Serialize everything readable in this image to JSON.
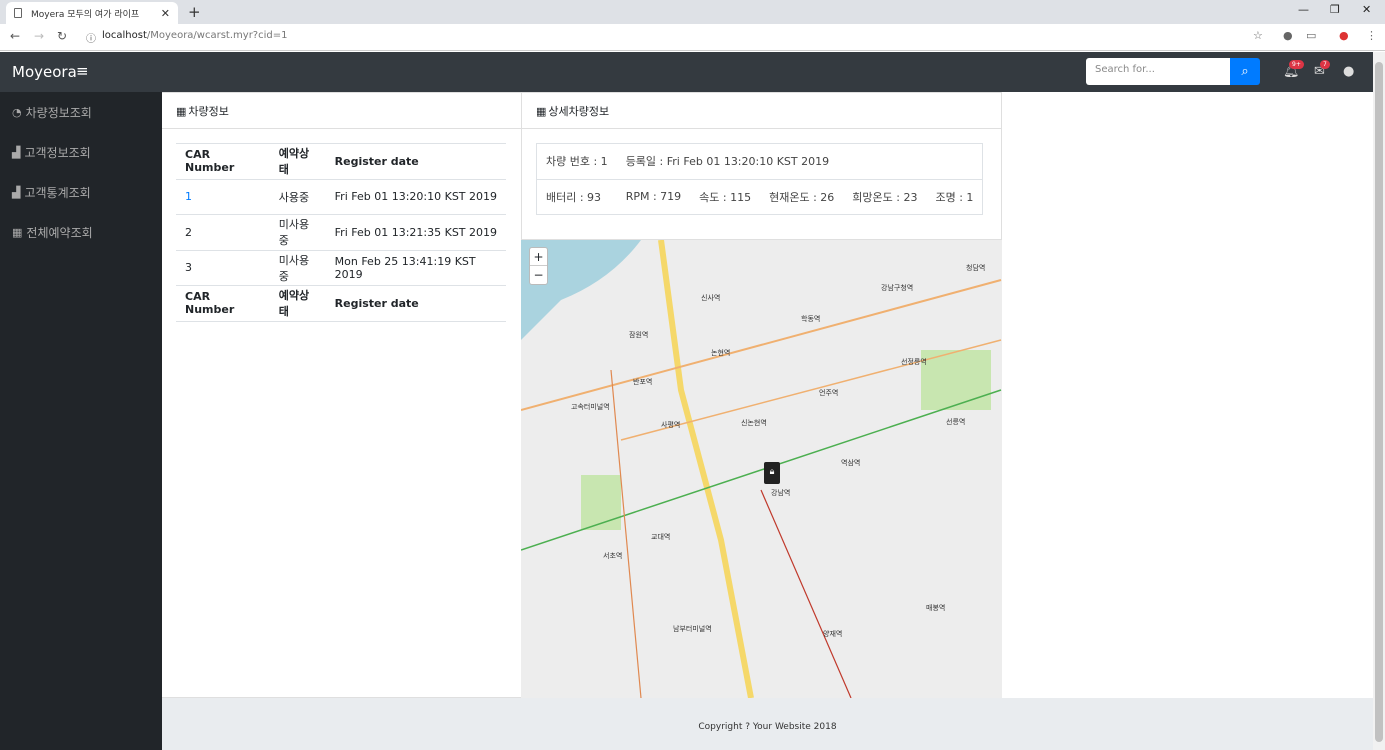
{
  "browser": {
    "tab_title": "Moyera 모두의 여가 라이프",
    "url_host": "localhost",
    "url_path": "/Moyeora/wcarst.myr?cid=1"
  },
  "header": {
    "brand": "Moyeora",
    "search_placeholder": "Search for...",
    "alerts_badge": "9+",
    "messages_badge": "7"
  },
  "sidebar": {
    "items": [
      {
        "label": "차량정보조회",
        "icon": "dashboard-icon"
      },
      {
        "label": "고객정보조회",
        "icon": "area-chart-icon"
      },
      {
        "label": "고객통계조회",
        "icon": "area-chart-icon"
      },
      {
        "label": "전체예약조회",
        "icon": "table-icon"
      }
    ]
  },
  "car_card": {
    "title": "차량정보",
    "headers": [
      "CAR Number",
      "예약상태",
      "Register date"
    ],
    "rows": [
      [
        "1",
        "사용중",
        "Fri Feb 01 13:20:10 KST 2019"
      ],
      [
        "2",
        "미사용중",
        "Fri Feb 01 13:21:35 KST 2019"
      ],
      [
        "3",
        "미사용중",
        "Mon Feb 25 13:41:19 KST 2019"
      ]
    ],
    "footer": [
      "CAR Number",
      "예약상태",
      "Register date"
    ]
  },
  "detail_card": {
    "title": "상세차량정보",
    "car_no": "차량 번호 : 1",
    "reg_date": "등록일 : Fri Feb 01 13:20:10 KST 2019",
    "battery": "배터리 : 93",
    "rpm": "RPM : 719",
    "speed": "속도 : 115",
    "cur_temp": "현재온도 : 26",
    "want_temp": "희망온도 : 23",
    "light": "조명 : 1"
  },
  "map": {
    "zoom_in": "+",
    "zoom_out": "−",
    "labels": [
      "신사역",
      "학동역",
      "강남구청역",
      "청담역",
      "잠원역",
      "논현역",
      "선정릉역",
      "반포역",
      "고속터미널역",
      "신논현역",
      "언주역",
      "선릉역",
      "사평역",
      "역삼역",
      "강남역",
      "교대역",
      "서초역",
      "남부터미널역",
      "양재역",
      "매봉역"
    ]
  },
  "footer": {
    "text": "Copyright ? Your Website 2018"
  }
}
